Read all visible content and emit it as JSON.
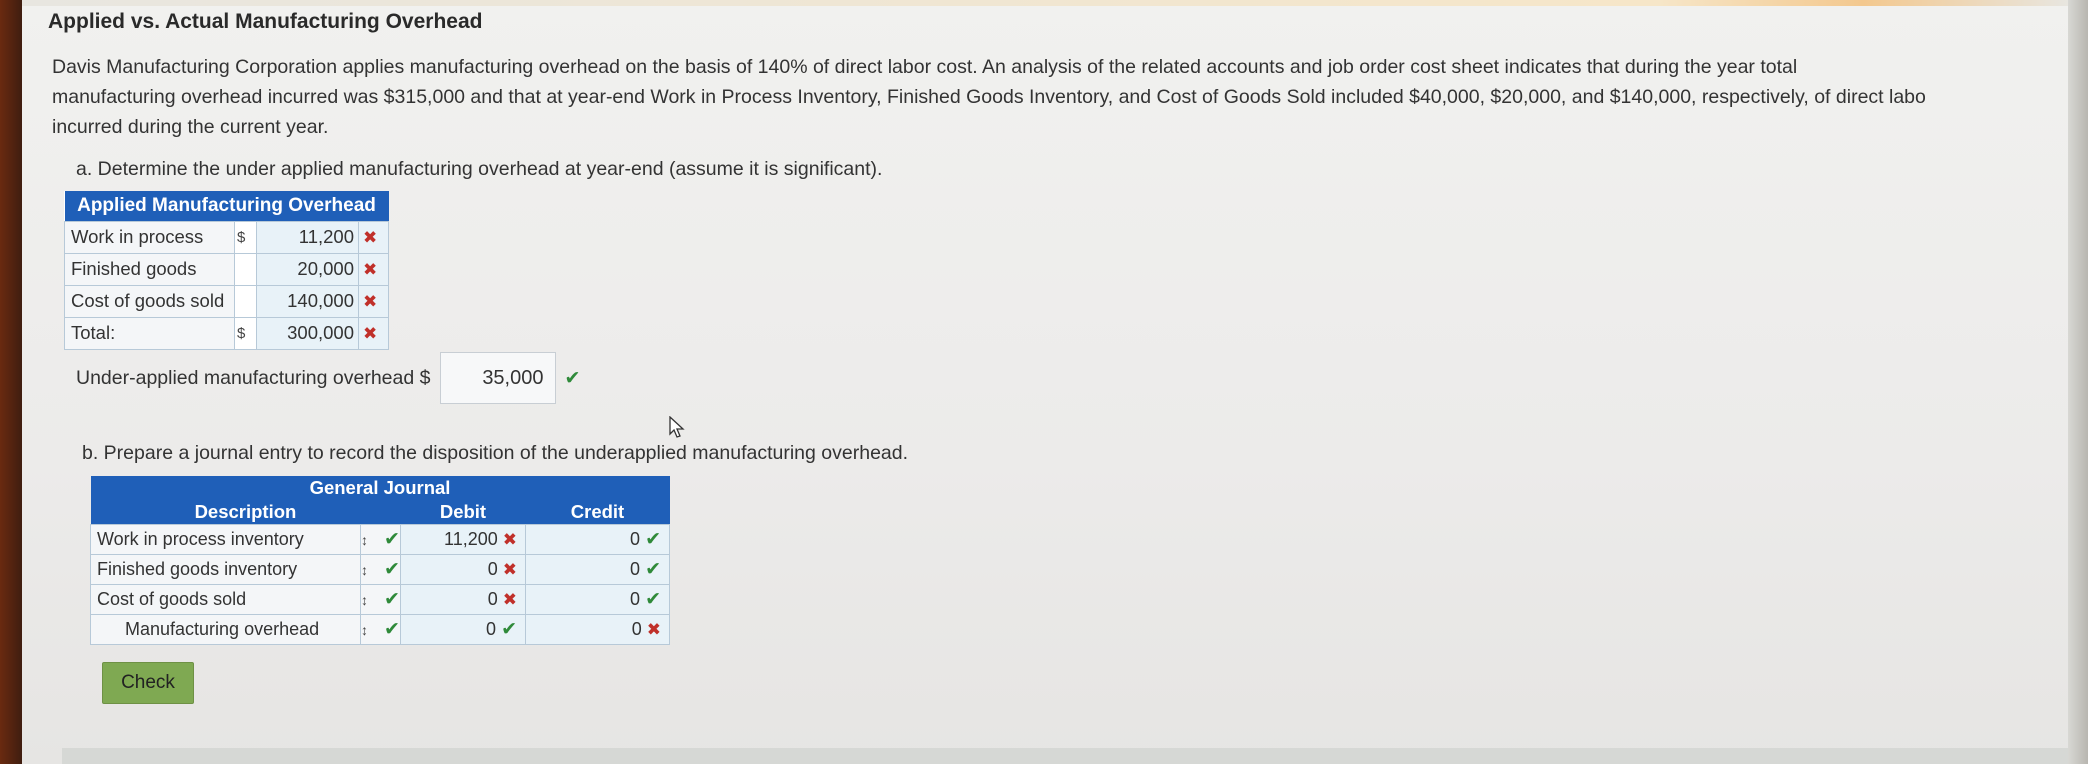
{
  "title": "Applied vs. Actual Manufacturing Overhead",
  "intro_lines": [
    "Davis Manufacturing Corporation applies manufacturing overhead on the basis of 140% of direct labor cost. An analysis of the related accounts and job order cost sheet indicates that during the year total",
    "manufacturing overhead incurred was $315,000 and that at year-end Work in Process Inventory, Finished Goods Inventory, and Cost of Goods Sold included $40,000, $20,000, and $140,000, respectively, of direct labo",
    "incurred during the current year."
  ],
  "part_a": {
    "prompt": "a. Determine the under applied manufacturing overhead at year-end (assume it is significant).",
    "table_header": "Applied Manufacturing Overhead",
    "rows": [
      {
        "label": "Work in process",
        "currency": "$",
        "value": "11,200",
        "status": "incorrect"
      },
      {
        "label": "Finished goods",
        "currency": "",
        "value": "20,000",
        "status": "incorrect"
      },
      {
        "label": "Cost of goods sold",
        "currency": "",
        "value": "140,000",
        "status": "incorrect"
      },
      {
        "label": "Total:",
        "currency": "$",
        "value": "300,000",
        "status": "incorrect"
      }
    ],
    "underapplied_label": "Under-applied manufacturing overhead $",
    "underapplied_value": "35,000",
    "underapplied_status": "correct"
  },
  "part_b": {
    "prompt": "b. Prepare a journal entry to record the disposition of the underapplied manufacturing overhead.",
    "journal_title": "General Journal",
    "columns": {
      "description": "Description",
      "debit": "Debit",
      "credit": "Credit"
    },
    "rows": [
      {
        "description": "Work in process inventory",
        "indent": false,
        "debit": "11,200",
        "debit_status": "incorrect",
        "credit": "0",
        "credit_status": "correct"
      },
      {
        "description": "Finished goods inventory",
        "indent": false,
        "debit": "0",
        "debit_status": "incorrect",
        "credit": "0",
        "credit_status": "correct"
      },
      {
        "description": "Cost of goods sold",
        "indent": false,
        "debit": "0",
        "debit_status": "incorrect",
        "credit": "0",
        "credit_status": "correct"
      },
      {
        "description": "Manufacturing overhead",
        "indent": true,
        "debit": "0",
        "debit_status": "correct",
        "credit": "0",
        "credit_status": "incorrect"
      }
    ]
  },
  "check_button": "Check",
  "marks": {
    "correct": "✔",
    "incorrect": "✖"
  },
  "colors": {
    "header_blue": "#1f5fb8",
    "correct_green": "#2f8a3a",
    "incorrect_red": "#c0302a",
    "check_button": "#7fa952"
  }
}
